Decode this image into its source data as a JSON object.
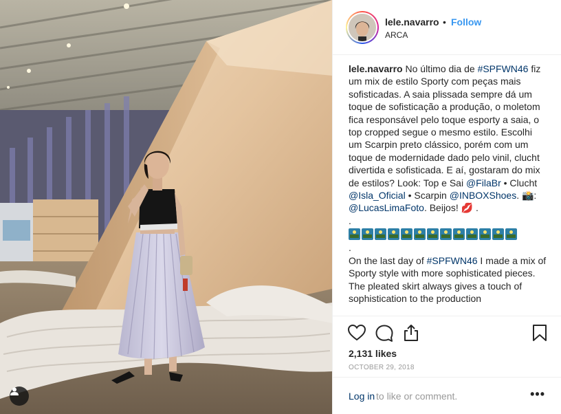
{
  "post": {
    "username": "lele.navarro",
    "follow_label": "Follow",
    "separator": "•",
    "location": "ARCA"
  },
  "caption": {
    "username": "lele.navarro",
    "seg1": " No último dia de ",
    "tag1": "#SPFWN46",
    "seg2": " fiz um mix de estilo Sporty com peças mais sofisticadas. A saia plissada sempre dá um toque de sofisticação a produção, o moletom fica responsável pelo toque esporty a saia, o top cropped segue o mesmo estilo. Escolhi um Scarpin preto clássico, porém com um toque de modernidade dado pelo vinil, clucht divertida e sofisticada. E aí, gostaram do mix de estilos? Look: Top e Sai ",
    "mention1": "@FilaBr",
    "seg3": " • Clucht ",
    "mention2": "@Isla_Oficial",
    "seg4": " • Scarpin ",
    "mention3": "@INBOXShoes",
    "seg5": ". 📸: ",
    "mention4": "@LucasLimaFoto",
    "seg6": ". Beijos! 💋 .",
    "dot_line": ".",
    "emoji_count": 13,
    "en_seg1": "On the last day of ",
    "en_tag1": "#SPFWN46",
    "en_seg2": " I made a mix of Sporty style with more sophisticated pieces. The pleated skirt always gives a touch of sophistication to the production"
  },
  "actions": {
    "like_icon": "heart-icon",
    "comment_icon": "comment-icon",
    "share_icon": "share-icon",
    "save_icon": "bookmark-icon"
  },
  "likes": "2,131 likes",
  "date": "OCTOBER 29, 2018",
  "comment_bar": {
    "login_link": "Log in",
    "login_rest": " to like or comment.",
    "more_label": "•••"
  },
  "colors": {
    "link": "#003569",
    "follow": "#3897f0",
    "muted": "#999999"
  }
}
